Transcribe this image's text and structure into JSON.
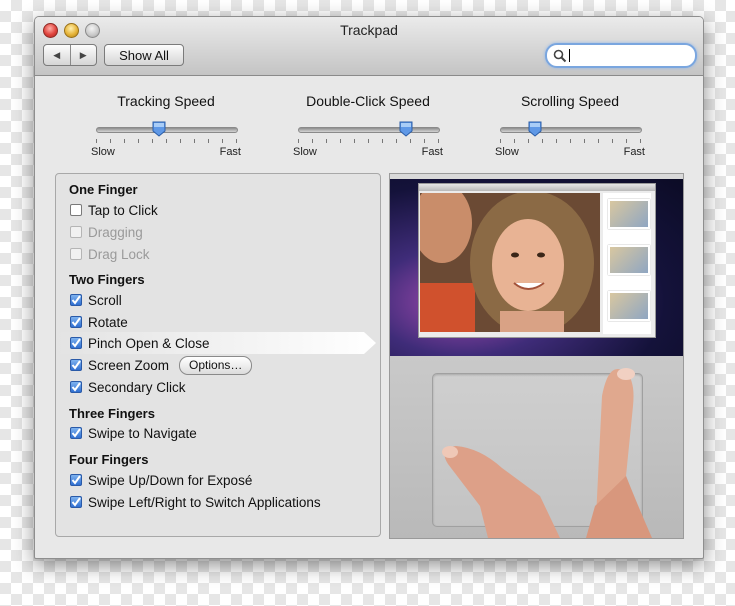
{
  "window": {
    "title": "Trackpad"
  },
  "toolbar": {
    "back_icon": "back-arrow",
    "forward_icon": "forward-arrow",
    "show_all_label": "Show All",
    "search": {
      "value": "",
      "placeholder": ""
    }
  },
  "sliders": [
    {
      "title": "Tracking Speed",
      "min_label": "Slow",
      "max_label": "Fast",
      "value": 0.45
    },
    {
      "title": "Double-Click Speed",
      "min_label": "Slow",
      "max_label": "Fast",
      "value": 0.77
    },
    {
      "title": "Scrolling Speed",
      "min_label": "Slow",
      "max_label": "Fast",
      "value": 0.25
    }
  ],
  "gestures": {
    "one_finger": {
      "heading": "One Finger",
      "items": [
        {
          "label": "Tap to Click",
          "checked": false,
          "enabled": true
        },
        {
          "label": "Dragging",
          "checked": false,
          "enabled": false
        },
        {
          "label": "Drag Lock",
          "checked": false,
          "enabled": false
        }
      ]
    },
    "two_fingers": {
      "heading": "Two Fingers",
      "items": [
        {
          "label": "Scroll",
          "checked": true,
          "enabled": true
        },
        {
          "label": "Rotate",
          "checked": true,
          "enabled": true
        },
        {
          "label": "Pinch Open & Close",
          "checked": true,
          "enabled": true,
          "selected": true
        },
        {
          "label": "Screen Zoom",
          "checked": true,
          "enabled": true
        },
        {
          "label": "Secondary Click",
          "checked": true,
          "enabled": true
        }
      ],
      "options_label": "Options…"
    },
    "three_fingers": {
      "heading": "Three Fingers",
      "items": [
        {
          "label": "Swipe to Navigate",
          "checked": true,
          "enabled": true
        }
      ]
    },
    "four_fingers": {
      "heading": "Four Fingers",
      "items": [
        {
          "label": "Swipe Up/Down for Exposé",
          "checked": true,
          "enabled": true
        },
        {
          "label": "Swipe Left/Right to Switch Applications",
          "checked": true,
          "enabled": true
        }
      ]
    }
  },
  "colors": {
    "accent": "#3b78d8",
    "window_bg": "#e8e8e8"
  }
}
